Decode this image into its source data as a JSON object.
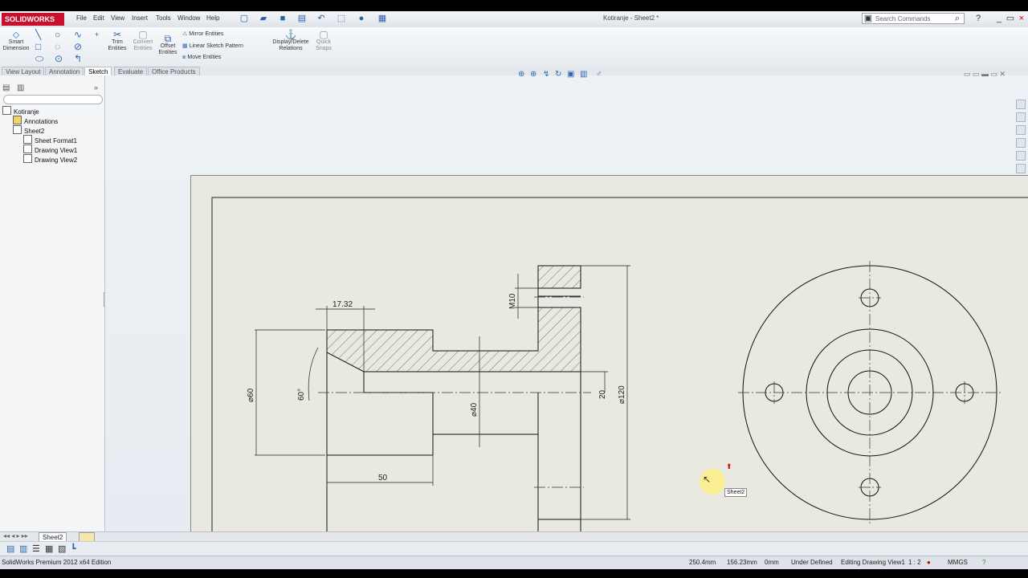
{
  "app": {
    "logo": "SOLIDWORKS",
    "menu": [
      "File",
      "Edit",
      "View",
      "Insert",
      "Tools",
      "Window",
      "Help"
    ],
    "document_title": "Kotiranje - Sheet2 *",
    "search_placeholder": "Search Commands"
  },
  "ribbon": {
    "smart_dimension": "Smart Dimension",
    "trim": "Trim Entities",
    "convert": "Convert Entities",
    "offset": "Offset Entities",
    "mirror": "Mirror Entities",
    "linear_pattern": "Linear Sketch Pattern",
    "move": "Move Entities",
    "display_relations": "Display/Delete Relations",
    "quick_snaps": "Quick Snaps"
  },
  "tabs": [
    "View Layout",
    "Annotation",
    "Sketch",
    "Evaluate",
    "Office Products"
  ],
  "active_tab": "Sketch",
  "tree": {
    "root": "Kotiranje",
    "annotations": "Annotations",
    "sheet": "Sheet2",
    "sheet_format": "Sheet Format1",
    "view1": "Drawing View1",
    "view2": "Drawing View2"
  },
  "drawing": {
    "dim_17_32": "17.32",
    "dim_m10": "M10",
    "dim_60": "⌀60",
    "dim_angle": "60°",
    "dim_40": "⌀40",
    "dim_20": "20",
    "dim_120": "⌀120",
    "dim_50": "50"
  },
  "tooltip": "Sheet2",
  "sheet_tab": "Sheet2",
  "status": {
    "edition": "SolidWorks Premium 2012 x64 Edition",
    "x": "250.4mm",
    "y": "156.23mm",
    "z": "0mm",
    "state": "Under Defined",
    "editing": "Editing Drawing View1",
    "scale": "1 : 2",
    "units": "MMGS"
  }
}
